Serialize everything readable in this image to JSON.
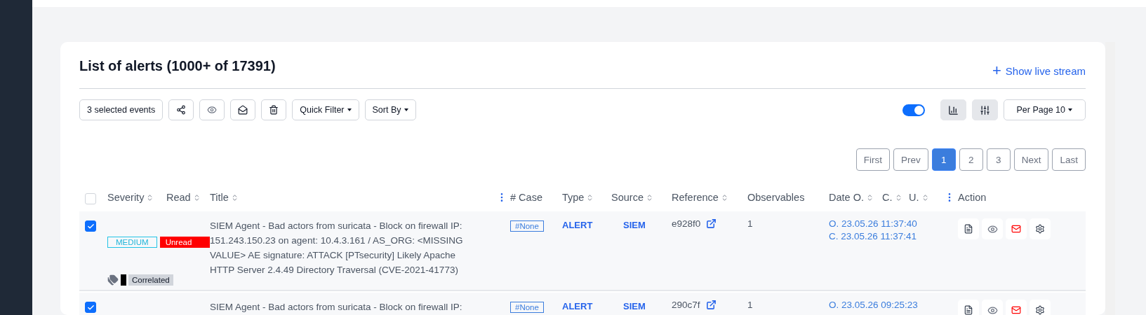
{
  "header": {
    "title": "List of alerts (1000+ of 17391)",
    "live_stream": "Show live stream",
    "live_stream_icon": "+"
  },
  "toolbar": {
    "selected_events": "3 selected events",
    "quick_filter": "Quick Filter",
    "sort_by": "Sort By",
    "toggle_on": true,
    "per_page": "Per Page 10"
  },
  "pagination": [
    {
      "label": "First",
      "selected": false
    },
    {
      "label": "Prev",
      "selected": false
    },
    {
      "label": "1",
      "selected": true
    },
    {
      "label": "2",
      "selected": false
    },
    {
      "label": "3",
      "selected": false
    },
    {
      "label": "Next",
      "selected": false
    },
    {
      "label": "Last",
      "selected": false
    }
  ],
  "table": {
    "all_checked": false,
    "columns": [
      {
        "label": "Severity",
        "sortable": true
      },
      {
        "label": "Read",
        "sortable": true
      },
      {
        "label": "Title",
        "sortable": true
      },
      {
        "label": "# Case",
        "sortable": false
      },
      {
        "label": "Type",
        "sortable": true
      },
      {
        "label": "Source",
        "sortable": true
      },
      {
        "label": "Reference",
        "sortable": true
      },
      {
        "label": "Observables",
        "sortable": false
      },
      {
        "label": "Date O.",
        "sortable": true
      },
      {
        "label": "C.",
        "sortable": true
      },
      {
        "label": "U.",
        "sortable": true
      },
      {
        "label": "Action",
        "sortable": false
      }
    ],
    "rows": [
      {
        "checked": true,
        "severity": "MEDIUM",
        "read": "Unread",
        "title": "SIEM Agent - Bad actors from suricata - Block on firewall IP: 151.243.150.23 on agent: 10.4.3.161 / AS_ORG: <MISSING VALUE> AE signature: ATTACK [PTsecurity] Likely Apache HTTP Server 2.4.49 Directory Traversal (CVE-2021-41773)",
        "case": "#None",
        "type": "ALERT",
        "source": "SIEM",
        "reference": "e928f0",
        "observables": "1",
        "dates": [
          "O. 23.05.26 11:37:40",
          "C. 23.05.26 11:37:41"
        ],
        "tags": [
          "Correlated"
        ]
      },
      {
        "checked": true,
        "title": "SIEM Agent - Bad actors from suricata - Block on firewall IP:",
        "case": "#None",
        "type": "ALERT",
        "source": "SIEM",
        "reference": "290c7f",
        "observables": "1",
        "dates": [
          "O. 23.05.26 09:25:23"
        ]
      }
    ]
  }
}
